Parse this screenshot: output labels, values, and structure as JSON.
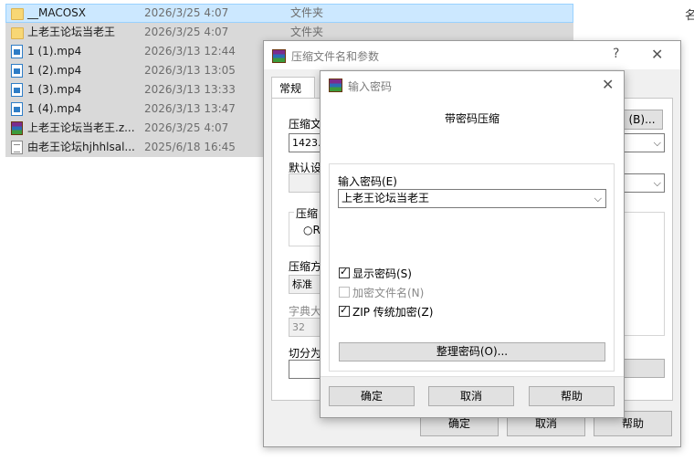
{
  "files": [
    {
      "icon": "folder-icon",
      "name": "__MACOSX",
      "date": "2026/3/25 4:07",
      "type": "文件夹"
    },
    {
      "icon": "folder-icon",
      "name": "上老王论坛当老王",
      "date": "2026/3/25 4:07",
      "type": "文件夹"
    },
    {
      "icon": "mp4-file-icon",
      "name": "1 (1).mp4",
      "date": "2026/3/13 12:44",
      "type": ""
    },
    {
      "icon": "mp4-file-icon",
      "name": "1 (2).mp4",
      "date": "2026/3/13 13:05",
      "type": ""
    },
    {
      "icon": "mp4-file-icon",
      "name": "1 (3).mp4",
      "date": "2026/3/13 13:33",
      "type": ""
    },
    {
      "icon": "mp4-file-icon",
      "name": "1 (4).mp4",
      "date": "2026/3/13 13:47",
      "type": ""
    },
    {
      "icon": "rar-archive-icon",
      "name": "上老王论坛当老王.z...",
      "date": "2026/3/25 4:07",
      "type": ""
    },
    {
      "icon": "text-file-icon",
      "name": "由老王论坛hjhhlsal...",
      "date": "2025/6/18 16:45",
      "type": ""
    }
  ],
  "edge_glyph": "名",
  "archive_dialog": {
    "title": "压缩文件名和参数",
    "help": "?",
    "close": "✕",
    "tab_general": "常规",
    "archive_name_label": "压缩文",
    "archive_name_value": "1423.z",
    "browse_button": "(B)...",
    "default_settings_label": "默认设",
    "format_group_label": "压缩",
    "format_radio_label": "R",
    "method_label": "压缩方",
    "method_value": "标准",
    "dict_label": "字典大",
    "dict_value": "32",
    "split_label": "切分为",
    "ok": "确定",
    "cancel": "取消",
    "help_button": "帮助"
  },
  "password_dialog": {
    "title": "输入密码",
    "close": "✕",
    "heading": "带密码压缩",
    "password_label": "输入密码(E)",
    "password_value": "上老王论坛当老王",
    "show_password": {
      "label": "显示密码(S)",
      "checked": true,
      "enabled": true
    },
    "encrypt_names": {
      "label": "加密文件名(N)",
      "checked": false,
      "enabled": false
    },
    "zip_legacy": {
      "label": "ZIP 传统加密(Z)",
      "checked": true,
      "enabled": true
    },
    "organize_button": "整理密码(O)...",
    "ok": "确定",
    "cancel": "取消",
    "help": "帮助"
  }
}
